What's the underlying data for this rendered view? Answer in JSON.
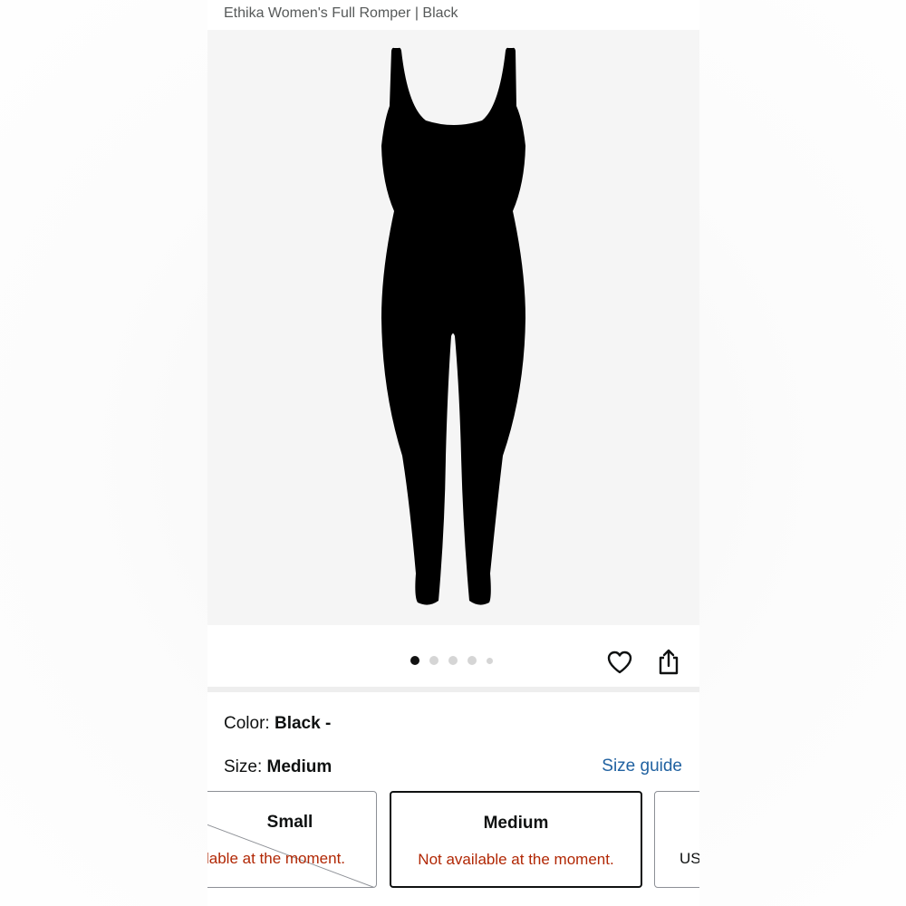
{
  "product": {
    "title": "Ethika Women's Full Romper | Black"
  },
  "gallery": {
    "image_alt": "Black full romper",
    "page_count": 5,
    "active_index": 0
  },
  "actions": {
    "wishlist_icon": "heart-icon",
    "share_icon": "share-icon"
  },
  "color": {
    "label": "Color:",
    "value": "Black -"
  },
  "size": {
    "label": "Size:",
    "value": "Medium",
    "guide_link": "Size guide"
  },
  "size_options": [
    {
      "name": "Small",
      "status": "lable at the moment.",
      "strikethrough": true
    },
    {
      "name": "Medium",
      "status": "Not available at the moment.",
      "selected": true
    },
    {
      "name": "",
      "status": "US"
    }
  ],
  "colors": {
    "status_red": "#b12704",
    "link_blue": "#2162a1",
    "text": "#0f1111"
  }
}
